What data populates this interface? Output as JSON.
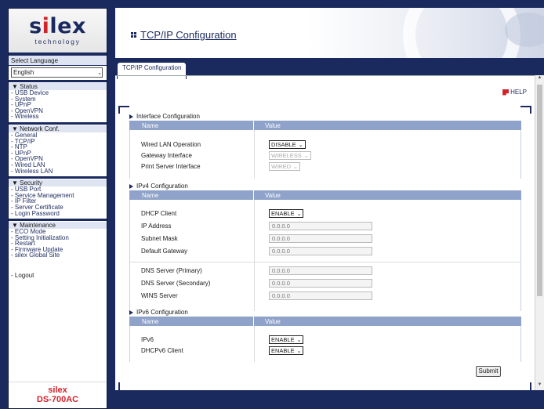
{
  "logo": {
    "word_main": "s",
    "word_accent": "i",
    "word_rest": "lex",
    "tagline": "technology"
  },
  "language": {
    "label": "Select Language",
    "selected": "English"
  },
  "nav": {
    "sections": [
      {
        "title": "▼ Status",
        "items": [
          "- USB Device",
          "- System",
          "- UPnP",
          "- OpenVPN",
          "- Wireless"
        ]
      },
      {
        "title": "▼ Network Conf.",
        "items": [
          "- General",
          "- TCP/IP",
          "- NTP",
          "- UPnP",
          "- OpenVPN",
          "- Wired LAN",
          "- Wireless LAN"
        ]
      },
      {
        "title": "▼ Security",
        "items": [
          "- USB Port",
          "- Service Management",
          "- IP Filter",
          "- Server Certificate",
          "- Login Password"
        ]
      },
      {
        "title": "▼ Maintenance",
        "items": [
          "- ECO Mode",
          "- Setting Initialization",
          "- Restart",
          "- Firmware Update",
          "- silex Global Site"
        ]
      }
    ],
    "logout": "- Logout"
  },
  "model": {
    "brand": "silex",
    "name": "DS-700AC"
  },
  "page": {
    "title": "TCP/IP Configuration",
    "tab": "TCP/IP Configuration",
    "help": "HELP"
  },
  "table_headers": {
    "name": "Name",
    "value": "Value"
  },
  "interface": {
    "title": "Interface Configuration",
    "wired_lan_label": "Wired LAN Operation",
    "wired_lan_value": "DISABLE",
    "gateway_label": "Gateway Interface",
    "gateway_value": "WIRELESS",
    "print_server_label": "Print Server Interface",
    "print_server_value": "WIRED"
  },
  "ipv4": {
    "title": "IPv4 Configuration",
    "dhcp_label": "DHCP Client",
    "dhcp_value": "ENABLE",
    "ip_label": "IP Address",
    "ip_value": "0.0.0.0",
    "mask_label": "Subnet Mask",
    "mask_value": "0.0.0.0",
    "gw_label": "Default Gateway",
    "gw_value": "0.0.0.0",
    "dns1_label": "DNS Server (Primary)",
    "dns1_value": "0.0.0.0",
    "dns2_label": "DNS Server (Secondary)",
    "dns2_value": "0.0.0.0",
    "wins_label": "WINS Server",
    "wins_value": "0.0.0.0"
  },
  "ipv6": {
    "title": "IPv6 Configuration",
    "ipv6_label": "IPv6",
    "ipv6_value": "ENABLE",
    "dhcpv6_label": "DHCPv6 Client",
    "dhcpv6_value": "ENABLE"
  },
  "submit_label": "Submit",
  "colors": {
    "navy": "#1b2a5e",
    "brand_red": "#d2232a",
    "table_header": "#8fa2c9"
  }
}
